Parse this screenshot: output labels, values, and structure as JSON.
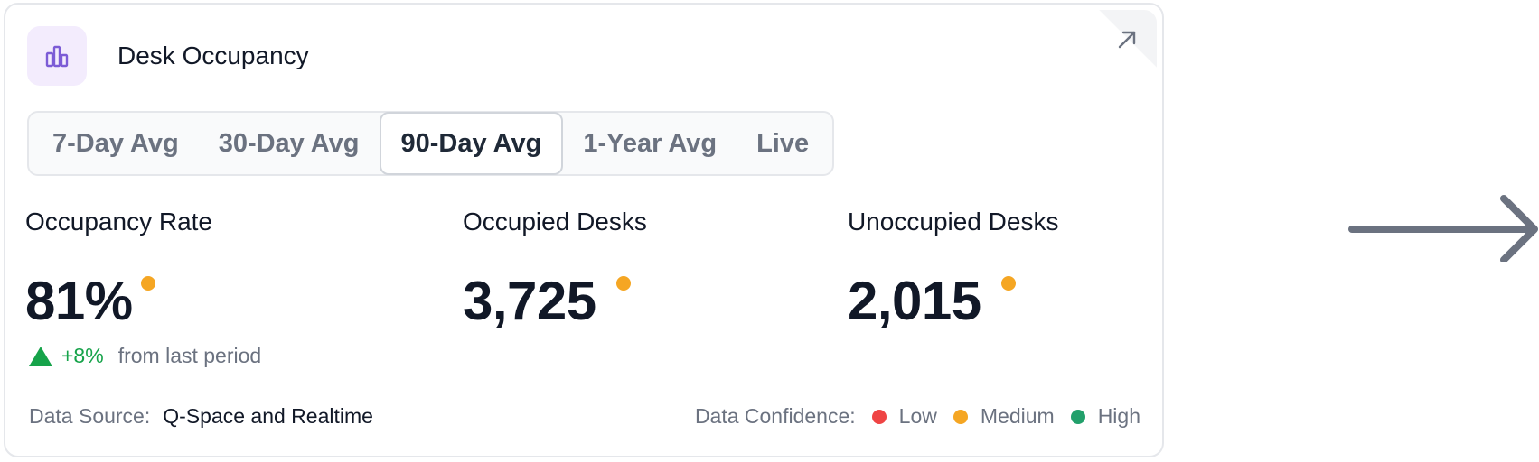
{
  "card": {
    "title": "Desk Occupancy",
    "header_icon": "bar-chart-icon",
    "expand_icon": "arrow-up-right-icon"
  },
  "tabs": [
    {
      "label": "7-Day Avg",
      "active": false
    },
    {
      "label": "30-Day Avg",
      "active": false
    },
    {
      "label": "90-Day Avg",
      "active": true
    },
    {
      "label": "1-Year Avg",
      "active": false
    },
    {
      "label": "Live",
      "active": false
    }
  ],
  "metrics": {
    "occupancy_rate": {
      "label": "Occupancy Rate",
      "value": "81%",
      "confidence": "Medium"
    },
    "occupied_desks": {
      "label": "Occupied Desks",
      "value": "3,725",
      "confidence": "Medium"
    },
    "unoccupied_desks": {
      "label": "Unoccupied Desks",
      "value": "2,015",
      "confidence": "Medium"
    }
  },
  "change": {
    "direction": "up",
    "value": "+8%",
    "text": "from last period"
  },
  "footer": {
    "data_source_label": "Data Source:",
    "data_source_value": "Q-Space and Realtime",
    "confidence_label": "Data Confidence:",
    "confidence_levels": [
      {
        "label": "Low",
        "color": "#ef4444"
      },
      {
        "label": "Medium",
        "color": "#f5a623"
      },
      {
        "label": "High",
        "color": "#22a06b"
      }
    ]
  },
  "colors": {
    "accent_purple": "#7c5cd6",
    "medium_dot": "#f5a623",
    "positive_green": "#16a34a"
  },
  "side_graphic": "arrow-right-icon"
}
